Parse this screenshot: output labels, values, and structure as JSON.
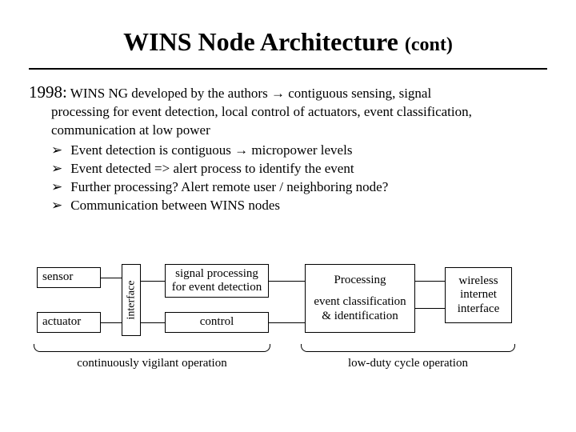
{
  "title": {
    "main": "WINS Node Architecture",
    "suffix": "(cont)"
  },
  "year": "1998:",
  "intro_line": "WINS NG developed by the authors",
  "arrow": "→",
  "intro_tail": "contiguous sensing, signal",
  "intro_hang": "processing for event detection, local control of actuators, event classification, communication at low power",
  "bullets": [
    "Event detection is contiguous → micropower levels",
    "Event detected => alert process to identify the event",
    "Further processing? Alert remote user / neighboring node?",
    "Communication between WINS nodes"
  ],
  "boxes": {
    "sensor": "sensor",
    "actuator": "actuator",
    "interface": "interface",
    "sigproc": "signal processing for event detection",
    "control": "control",
    "processing_title": "Processing",
    "processing_sub": "event classification & identification",
    "wireless": "wireless internet interface"
  },
  "captions": {
    "left": "continuously vigilant operation",
    "right": "low-duty cycle operation"
  }
}
